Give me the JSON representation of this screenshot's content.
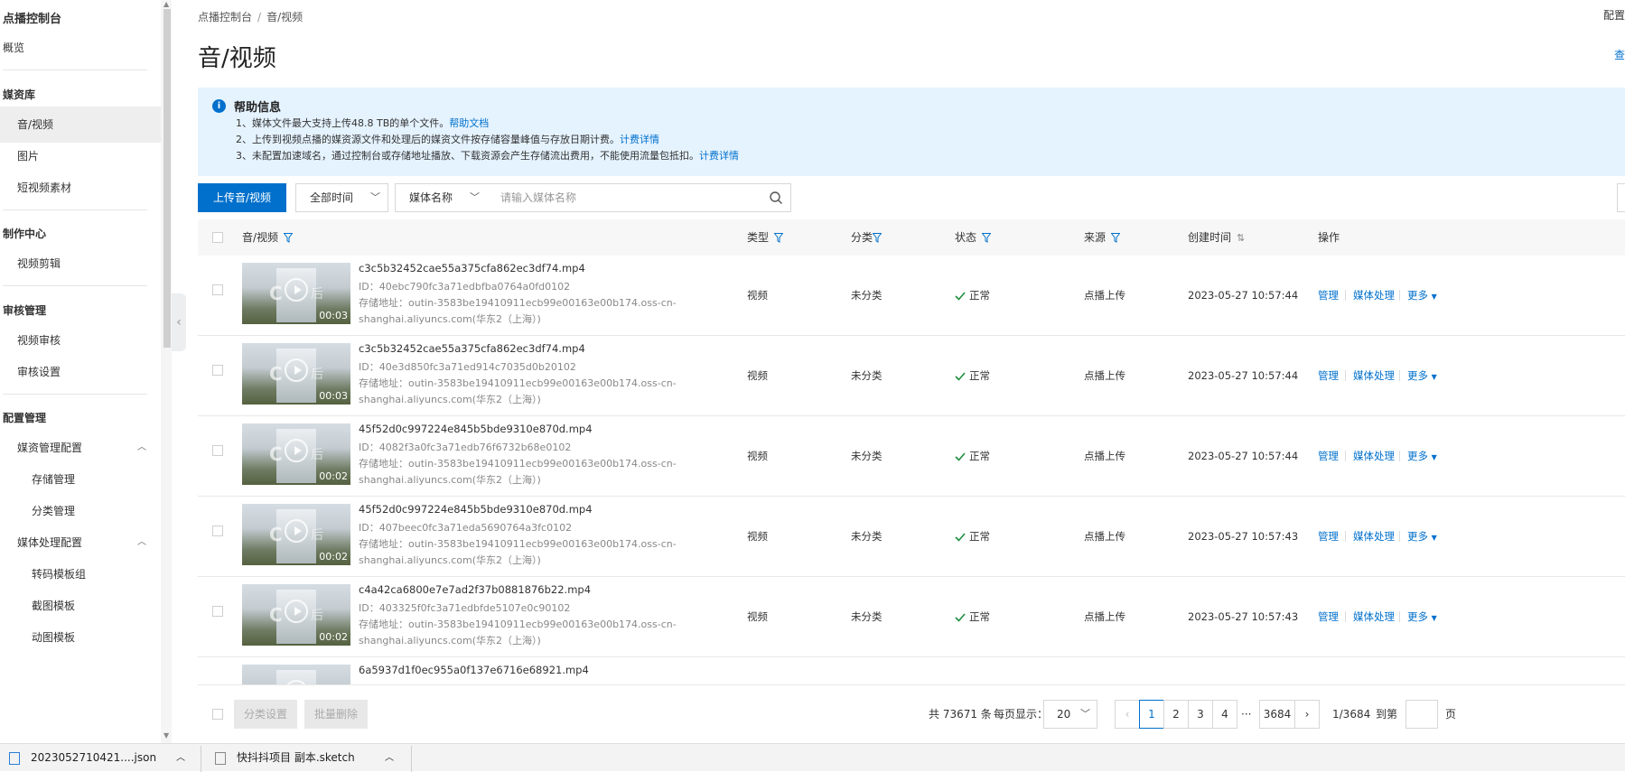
{
  "sidebar": {
    "title": "点播控制台",
    "overview": "概览",
    "media_library": "媒资库",
    "audio_video": "音/视频",
    "images": "图片",
    "short_video": "短视频素材",
    "production_center": "制作中心",
    "video_editing": "视频剪辑",
    "review_management": "审核管理",
    "video_review": "视频审核",
    "review_settings": "审核设置",
    "config_management": "配置管理",
    "media_mgmt_config": "媒资管理配置",
    "storage_mgmt": "存储管理",
    "category_mgmt": "分类管理",
    "media_process_config": "媒体处理配置",
    "transcode_template_group": "转码模板组",
    "snapshot_template": "截图模板",
    "animation_template": "动图模板"
  },
  "header": {
    "breadcrumb_root": "点播控制台",
    "breadcrumb_sep": "/",
    "breadcrumb_current": "音/视频",
    "title": "音/视频",
    "top_right": "配置",
    "top_right2": "查"
  },
  "help": {
    "title": "帮助信息",
    "line1_text": "1、媒体文件最大支持上传48.8 TB的单个文件。",
    "line1_link": "帮助文档",
    "line2_text": "2、上传到视频点播的媒资源文件和处理后的媒资文件按存储容量峰值与存放日期计费。",
    "line2_link": "计费详情",
    "line3_text": "3、未配置加速域名，通过控制台或存储地址播放、下载资源会产生存储流出费用，不能使用流量包抵扣。",
    "line3_link": "计费详情"
  },
  "toolbar": {
    "upload_label": "上传音/视频",
    "time_filter": "全部时间",
    "name_filter": "媒体名称",
    "search_placeholder": "请输入媒体名称"
  },
  "table": {
    "headers": {
      "media": "音/视频",
      "type": "类型",
      "category": "分类",
      "status": "状态",
      "source": "来源",
      "created": "创建时间",
      "actions": "操作"
    },
    "action_labels": {
      "manage": "管理",
      "process": "媒体处理",
      "more": "更多"
    },
    "rows": [
      {
        "name": "c3c5b32452cae55a375cfa862ec3df74.mp4",
        "id": "ID：40ebc790fc3a71edbfba0764a0fd0102",
        "addr1": "存储地址：outin-3583be19410911ecb99e00163e00b174.oss-cn-",
        "addr2": "shanghai.aliyuncs.com(华东2（上海）)",
        "duration": "00:03",
        "type": "视频",
        "category": "未分类",
        "status": "正常",
        "source": "点播上传",
        "created": "2023-05-27 10:57:44"
      },
      {
        "name": "c3c5b32452cae55a375cfa862ec3df74.mp4",
        "id": "ID：40e3d850fc3a71ed914c7035d0b20102",
        "addr1": "存储地址：outin-3583be19410911ecb99e00163e00b174.oss-cn-",
        "addr2": "shanghai.aliyuncs.com(华东2（上海）)",
        "duration": "00:03",
        "type": "视频",
        "category": "未分类",
        "status": "正常",
        "source": "点播上传",
        "created": "2023-05-27 10:57:44"
      },
      {
        "name": "45f52d0c997224e845b5bde9310e870d.mp4",
        "id": "ID：4082f3a0fc3a71edb76f6732b68e0102",
        "addr1": "存储地址：outin-3583be19410911ecb99e00163e00b174.oss-cn-",
        "addr2": "shanghai.aliyuncs.com(华东2（上海）)",
        "duration": "00:02",
        "type": "视频",
        "category": "未分类",
        "status": "正常",
        "source": "点播上传",
        "created": "2023-05-27 10:57:44"
      },
      {
        "name": "45f52d0c997224e845b5bde9310e870d.mp4",
        "id": "ID：407beec0fc3a71eda5690764a3fc0102",
        "addr1": "存储地址：outin-3583be19410911ecb99e00163e00b174.oss-cn-",
        "addr2": "shanghai.aliyuncs.com(华东2（上海）)",
        "duration": "00:02",
        "type": "视频",
        "category": "未分类",
        "status": "正常",
        "source": "点播上传",
        "created": "2023-05-27 10:57:43"
      },
      {
        "name": "c4a42ca6800e7e7ad2f37b0881876b22.mp4",
        "id": "ID：403325f0fc3a71edbfde5107e0c90102",
        "addr1": "存储地址：outin-3583be19410911ecb99e00163e00b174.oss-cn-",
        "addr2": "shanghai.aliyuncs.com(华东2（上海）)",
        "duration": "00:02",
        "type": "视频",
        "category": "未分类",
        "status": "正常",
        "source": "点播上传",
        "created": "2023-05-27 10:57:43"
      },
      {
        "name": "6a5937d1f0ec955a0f137e6716e68921.mp4"
      }
    ]
  },
  "footer": {
    "category_setting": "分类设置",
    "batch_delete": "批量删除",
    "total": "共 73671 条",
    "per_page_label": "每页显示：",
    "per_page_value": "20",
    "pages": [
      "1",
      "2",
      "3",
      "4"
    ],
    "ellipsis": "···",
    "last_page": "3684",
    "page_indicator": "1/3684",
    "goto_label": "到第",
    "page_unit": "页"
  },
  "taskbar": {
    "file1": "2023052710421....json",
    "file2": "快抖抖项目 副本.sketch"
  },
  "colors": {
    "accent": "#0070cc",
    "help_bg": "#e5f3ff",
    "success": "#1e8e3e"
  }
}
